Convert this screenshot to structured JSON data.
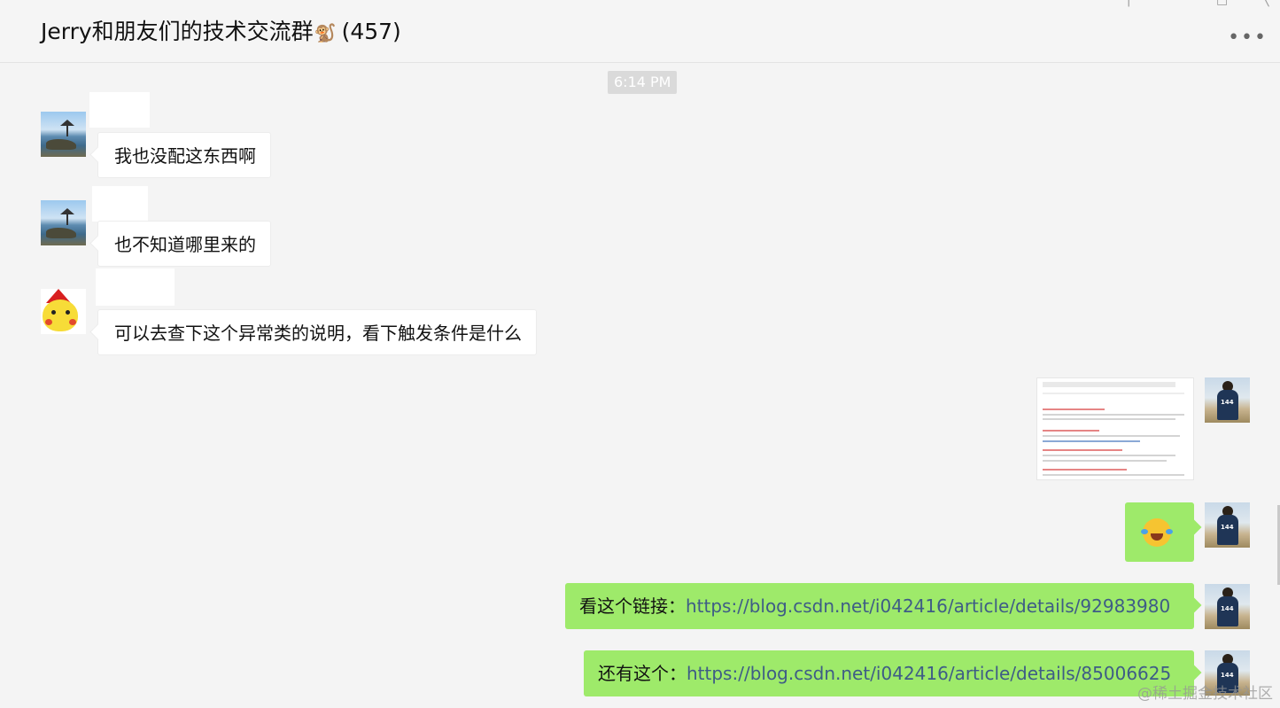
{
  "header": {
    "title": "Jerry和朋友们的技术交流群",
    "title_emoji": "🐒",
    "member_count": "(457)",
    "more_icon": "more-dots-icon"
  },
  "timestamp": "6:14 PM",
  "messages": [
    {
      "direction": "in",
      "avatar": "beach-avatar",
      "text": "我也没配这东西啊"
    },
    {
      "direction": "in",
      "avatar": "beach-avatar",
      "text": "也不知道哪里来的"
    },
    {
      "direction": "in",
      "avatar": "pikachu-avatar",
      "text": "可以去查下这个异常类的说明，看下触发条件是什么"
    },
    {
      "direction": "out",
      "avatar": "player-avatar",
      "type": "image",
      "content": "search-results-screenshot"
    },
    {
      "direction": "out",
      "avatar": "player-avatar",
      "type": "emoji",
      "content": "laughing-crying-emoji"
    },
    {
      "direction": "out",
      "avatar": "player-avatar",
      "prefix": "看这个链接：",
      "link": "https://blog.csdn.net/i042416/article/details/92983980"
    },
    {
      "direction": "out",
      "avatar": "player-avatar",
      "prefix": "还有这个：",
      "link": "https://blog.csdn.net/i042416/article/details/85006625"
    }
  ],
  "watermark": "@稀土掘金技术社区"
}
